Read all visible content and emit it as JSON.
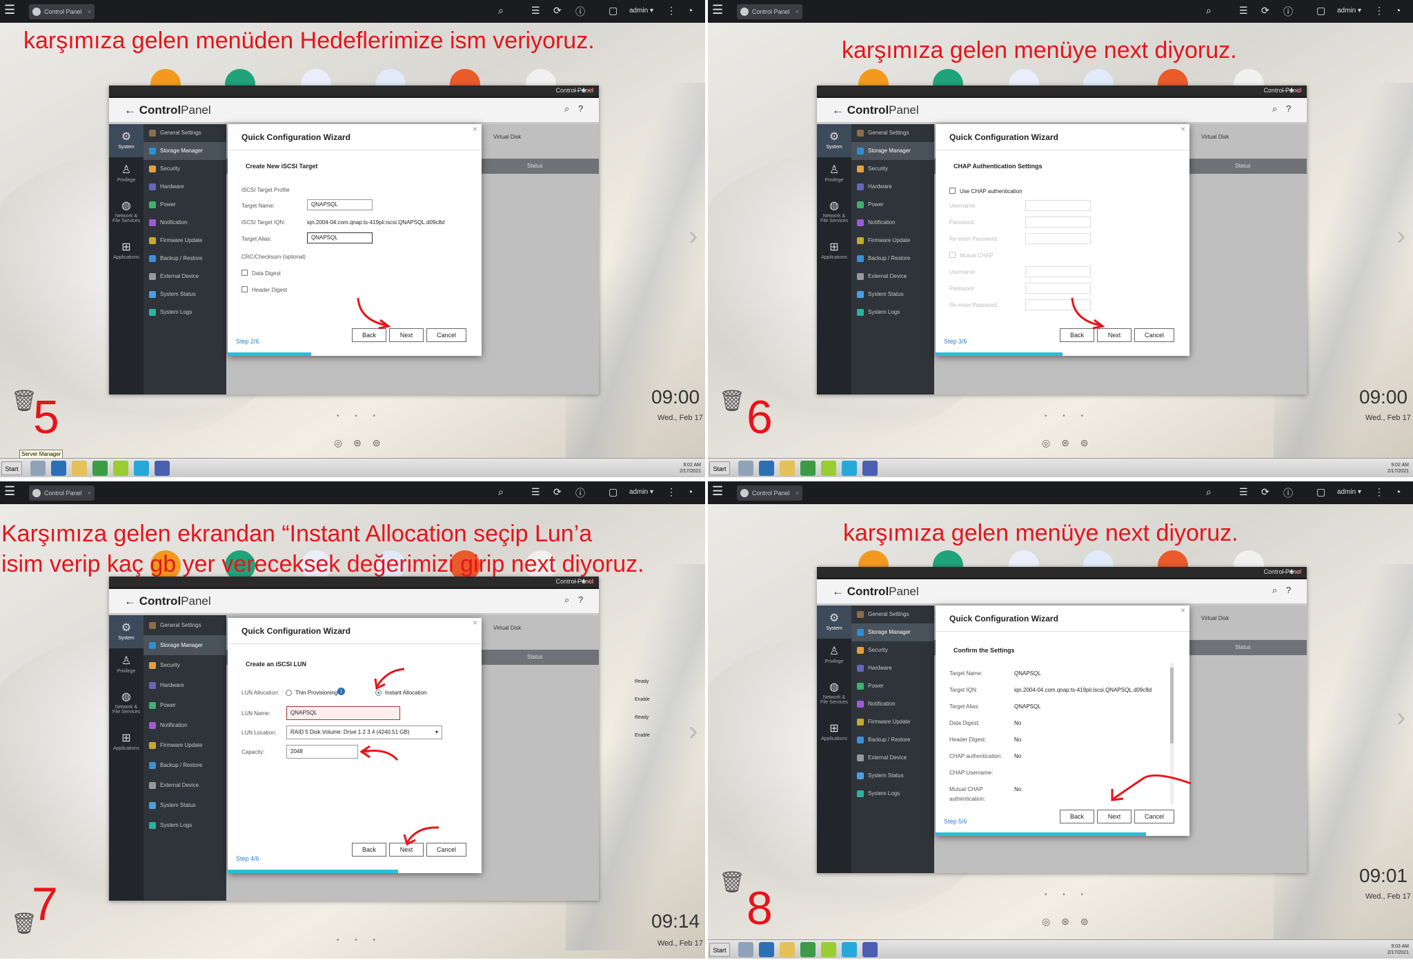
{
  "common": {
    "tab_title": "Control Panel",
    "admin": "admin ▾",
    "window_title": "Control Panel",
    "app_title_a": "Control",
    "app_title_b": "Panel",
    "virtual_disk": "Virtual Disk",
    "status_col": "Status",
    "wizard_title": "Quick Configuration Wizard",
    "back": "Back",
    "next": "Next",
    "cancel": "Cancel",
    "start": "Start",
    "tray_time": "9:02 AM",
    "tray_date": "2/17/2021",
    "tray_time8": "9:03 AM",
    "dots": "• • •",
    "tools": "◎ ⊛ ⊚"
  },
  "side": {
    "system": "System",
    "privilege": "Privilege",
    "network1": "Network &",
    "network2": "File Services",
    "apps": "Applications"
  },
  "nav": [
    "General Settings",
    "Storage Manager",
    "Security",
    "Hardware",
    "Power",
    "Notification",
    "Firmware Update",
    "Backup / Restore",
    "External Device",
    "System Status",
    "System Logs"
  ],
  "p5": {
    "caption": "karşımıza gelen menüden Hedeflerimize ism veriyoruz.",
    "number": "5",
    "time": "09:00",
    "date": "Wed., Feb 17",
    "tooltip": "Server Manager",
    "section": "Create New iSCSI Target",
    "profile": "iSCSI Target Profile",
    "target_name_label": "Target Name:",
    "target_name": "QNAPSQL",
    "iqn_label": "iSCSI Target IQN:",
    "iqn": "iqn.2004-04.com.qnap:ts-419pii:iscsi.QNAPSQL.d09c8d",
    "alias_label": "Target Alias:",
    "alias": "QNAPSQL",
    "crc": "CRC/Checksum (optional)",
    "data_digest": "Data Digest",
    "header_digest": "Header Digest",
    "step": "Step 2/6",
    "progress": 0.33
  },
  "p6": {
    "caption": "karşımıza gelen menüye next diyoruz.",
    "number": "6",
    "time": "09:00",
    "date": "Wed., Feb 17",
    "section": "CHAP Authentication Settings",
    "use_chap": "Use CHAP authentication",
    "username": "Username:",
    "password": "Password:",
    "reenter": "Re-enter Password:",
    "mutual": "Mutual CHAP",
    "step": "Step 3/6",
    "progress": 0.5
  },
  "p7": {
    "caption1": "Karşımıza gelen ekrandan “Instant Allocation seçip Lun’a",
    "caption2": "isim verip kaç gb yer vereceksek değerimizi girip next diyoruz.",
    "number": "7",
    "time": "09:14",
    "date": "Wed., Feb 17",
    "section": "Create an iSCSI LUN",
    "alloc_label": "LUN Allocation:",
    "thin": "Thin Provisioning",
    "instant": "Instant Allocation",
    "name_label": "LUN Name:",
    "lun_name": "QNAPSQL",
    "loc_label": "LUN Location:",
    "location": "RAID 5 Disk Volume: Drive 1 2 3 4 (4240.51 GB)",
    "cap_label": "Capacity:",
    "capacity": "2048",
    "unit": "GB",
    "step": "Step 4/6",
    "progress": 0.67,
    "statuses": [
      "Ready",
      "Enable",
      "Ready",
      "Enable"
    ]
  },
  "p8": {
    "caption": "karşımıza gelen menüye next diyoruz.",
    "number": "8",
    "time": "09:01",
    "date": "Wed., Feb 17",
    "section": "Confirm the Settings",
    "rows": [
      [
        "Target Name:",
        "QNAPSQL"
      ],
      [
        "Target IQN:",
        "iqn.2004-04.com.qnap:ts-419pii:iscsi.QNAPSQL.d09c8d"
      ],
      [
        "Target Alias:",
        "QNAPSQL"
      ],
      [
        "Data Digest:",
        "No"
      ],
      [
        "Header Digest:",
        "No"
      ],
      [
        "CHAP authentication:",
        "No"
      ],
      [
        "CHAP Username:",
        ""
      ],
      [
        "Mutual CHAP",
        "No"
      ]
    ],
    "mutual_cont": "authentication:",
    "step": "Step 5/6",
    "progress": 0.83
  }
}
